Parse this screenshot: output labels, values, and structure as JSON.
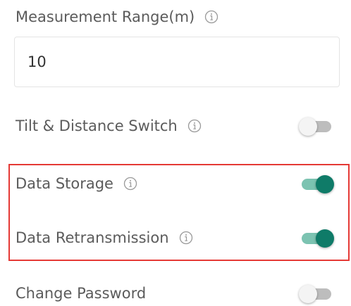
{
  "fields": {
    "measurement_range": {
      "label": "Measurement Range(m)",
      "value": "10"
    },
    "tilt_distance_switch": {
      "label": "Tilt & Distance Switch",
      "enabled": false
    },
    "data_storage": {
      "label": "Data Storage",
      "enabled": true
    },
    "data_retransmission": {
      "label": "Data Retransmission",
      "enabled": true
    },
    "change_password": {
      "label": "Change Password",
      "enabled": false
    }
  },
  "colors": {
    "toggle_on_knob": "#0f7b68",
    "toggle_on_track": "#7cc3b1",
    "toggle_off_knob": "#f4f4f4",
    "toggle_off_track": "#bdbdbd",
    "highlight_border": "#e53935"
  },
  "icons": {
    "info": "info-circle-icon"
  }
}
